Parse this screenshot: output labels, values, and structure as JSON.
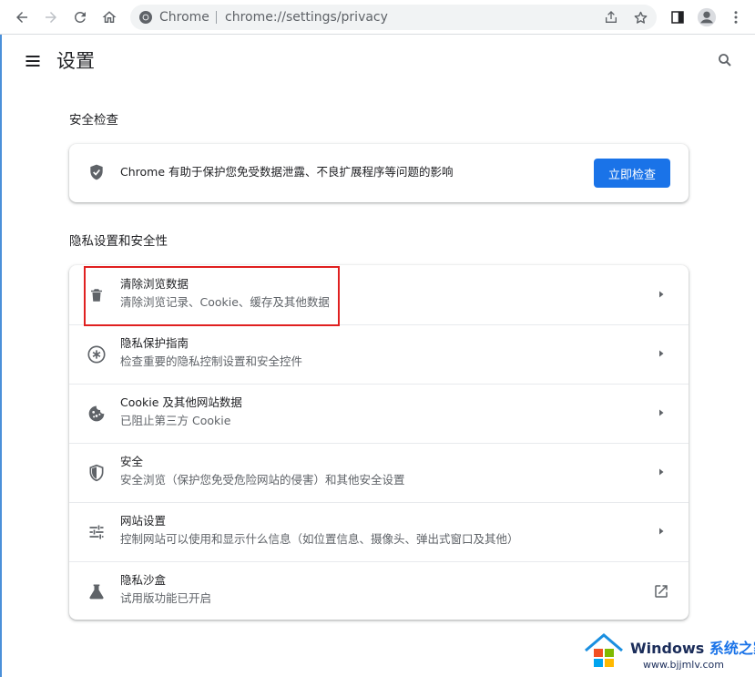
{
  "browser": {
    "omnibox_site": "Chrome",
    "omnibox_url": "chrome://settings/privacy"
  },
  "header": {
    "title": "设置"
  },
  "safety_check": {
    "section_label": "安全检查",
    "description": "Chrome 有助于保护您免受数据泄露、不良扩展程序等问题的影响",
    "button_label": "立即检查"
  },
  "privacy": {
    "section_label": "隐私设置和安全性",
    "items": [
      {
        "title": "清除浏览数据",
        "subtitle": "清除浏览记录、Cookie、缓存及其他数据",
        "icon": "trash-icon"
      },
      {
        "title": "隐私保护指南",
        "subtitle": "检查重要的隐私控制设置和安全控件",
        "icon": "privacy-guide-icon"
      },
      {
        "title": "Cookie 及其他网站数据",
        "subtitle": "已阻止第三方 Cookie",
        "icon": "cookie-icon"
      },
      {
        "title": "安全",
        "subtitle": "安全浏览（保护您免受危险网站的侵害）和其他安全设置",
        "icon": "security-shield-icon"
      },
      {
        "title": "网站设置",
        "subtitle": "控制网站可以使用和显示什么信息（如位置信息、摄像头、弹出式窗口及其他）",
        "icon": "tune-icon"
      },
      {
        "title": "隐私沙盒",
        "subtitle": "试用版功能已开启",
        "icon": "flask-icon"
      }
    ]
  },
  "watermark": {
    "brand": "Windows",
    "brand_cn": "系统之家",
    "url": "www.bjjmlv.com"
  },
  "colors": {
    "accent": "#1a73e8",
    "highlight_box": "#e02020",
    "text_primary": "#202124",
    "text_secondary": "#5f6368"
  }
}
